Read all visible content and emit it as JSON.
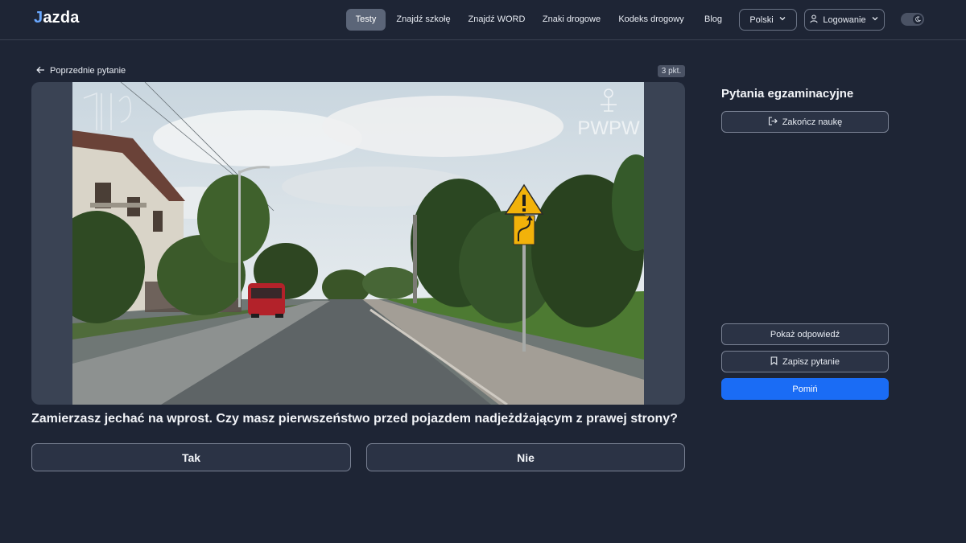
{
  "header": {
    "logo_prefix": "J",
    "logo_rest": "azda",
    "nav": [
      "Testy",
      "Znajdź szkołę",
      "Znajdź WORD",
      "Znaki drogowe",
      "Kodeks drogowy",
      "Blog"
    ],
    "language": "Polski",
    "login": "Logowanie"
  },
  "question": {
    "back_label": "Poprzednie pytanie",
    "points": "3 pkt.",
    "watermark": "PWPW",
    "text": "Zamierzasz jechać na wprost. Czy masz pierwszeństwo przed pojazdem nadjeżdżającym z prawej strony?",
    "answers": [
      "Tak",
      "Nie"
    ]
  },
  "sidebar": {
    "title": "Pytania egzaminacyjne",
    "finish": "Zakończ naukę",
    "show_answer": "Pokaż odpowiedź",
    "save_question": "Zapisz pytanie",
    "skip": "Pomiń"
  },
  "colors": {
    "background": "#1e2535",
    "accent": "#1a6cf5",
    "active_nav": "#5b6578"
  }
}
